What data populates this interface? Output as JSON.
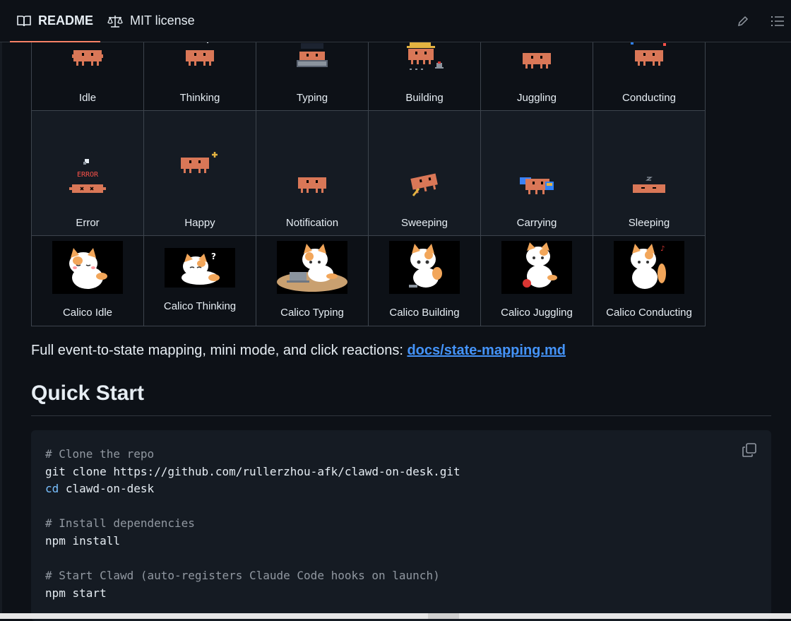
{
  "tabs": [
    {
      "label": "README",
      "icon": "book-icon",
      "active": true
    },
    {
      "label": "MIT license",
      "icon": "scale-icon",
      "active": false
    }
  ],
  "toolbar": {
    "edit_icon": "pencil-icon",
    "outline_icon": "list-icon"
  },
  "grid": {
    "row1": [
      "Idle",
      "Thinking",
      "Typing",
      "Building",
      "Juggling",
      "Conducting"
    ],
    "row2": [
      "Error",
      "Happy",
      "Notification",
      "Sweeping",
      "Carrying",
      "Sleeping"
    ],
    "row3": [
      "Calico Idle",
      "Calico Thinking",
      "Calico Typing",
      "Calico Building",
      "Calico Juggling",
      "Calico Conducting"
    ],
    "error_text": "ERROR"
  },
  "mapping": {
    "text": "Full event-to-state mapping, mini mode, and click reactions: ",
    "link": "docs/state-mapping.md"
  },
  "quickstart": {
    "heading": "Quick Start",
    "lines": {
      "c1": "# Clone the repo",
      "l1": "git clone https://github.com/rullerzhou-afk/clawd-on-desk.git",
      "l2_kw": "cd",
      "l2_rest": " clawd-on-desk",
      "c2": "# Install dependencies",
      "l3": "npm install",
      "c3": "# Start Clawd (auto-registers Claude Code hooks on launch)",
      "l4": "npm start"
    }
  },
  "colors": {
    "background": "#0d1117",
    "link": "#4493f8",
    "sprite": "#d97757",
    "active_tab_underline": "#f78166"
  }
}
